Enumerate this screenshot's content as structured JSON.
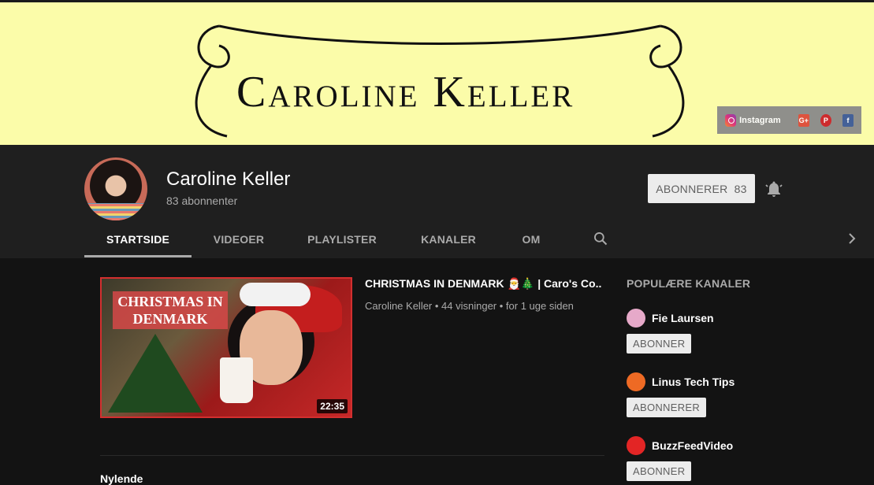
{
  "banner": {
    "title": "Caroline Keller",
    "social": {
      "instagram": "Instagram",
      "gplus": "G+",
      "pinterest": "P",
      "facebook": "f"
    }
  },
  "channel": {
    "name": "Caroline Keller",
    "subscribers": "83 abonnenter",
    "subscribe_label": "ABONNERER",
    "subscribe_count": "83"
  },
  "tabs": [
    {
      "label": "STARTSIDE",
      "active": true
    },
    {
      "label": "VIDEOER"
    },
    {
      "label": "PLAYLISTER"
    },
    {
      "label": "KANALER"
    },
    {
      "label": "OM"
    }
  ],
  "featured": {
    "thumb_text": "CHRISTMAS IN DENMARK",
    "duration": "22:35",
    "title": "CHRISTMAS IN DENMARK 🎅🎄 | Caro's Co...",
    "meta": "Caroline Keller • 44 visninger • for 1 uge siden"
  },
  "next_section": "Nylende",
  "popular": {
    "title": "POPULÆRE KANALER",
    "channels": [
      {
        "name": "Fie Laursen",
        "button": "ABONNER",
        "color": "#e6a9c9"
      },
      {
        "name": "Linus Tech Tips",
        "button": "ABONNERER",
        "color": "#ee6a24"
      },
      {
        "name": "BuzzFeedVideo",
        "button": "ABONNER",
        "color": "#e32525"
      }
    ]
  }
}
